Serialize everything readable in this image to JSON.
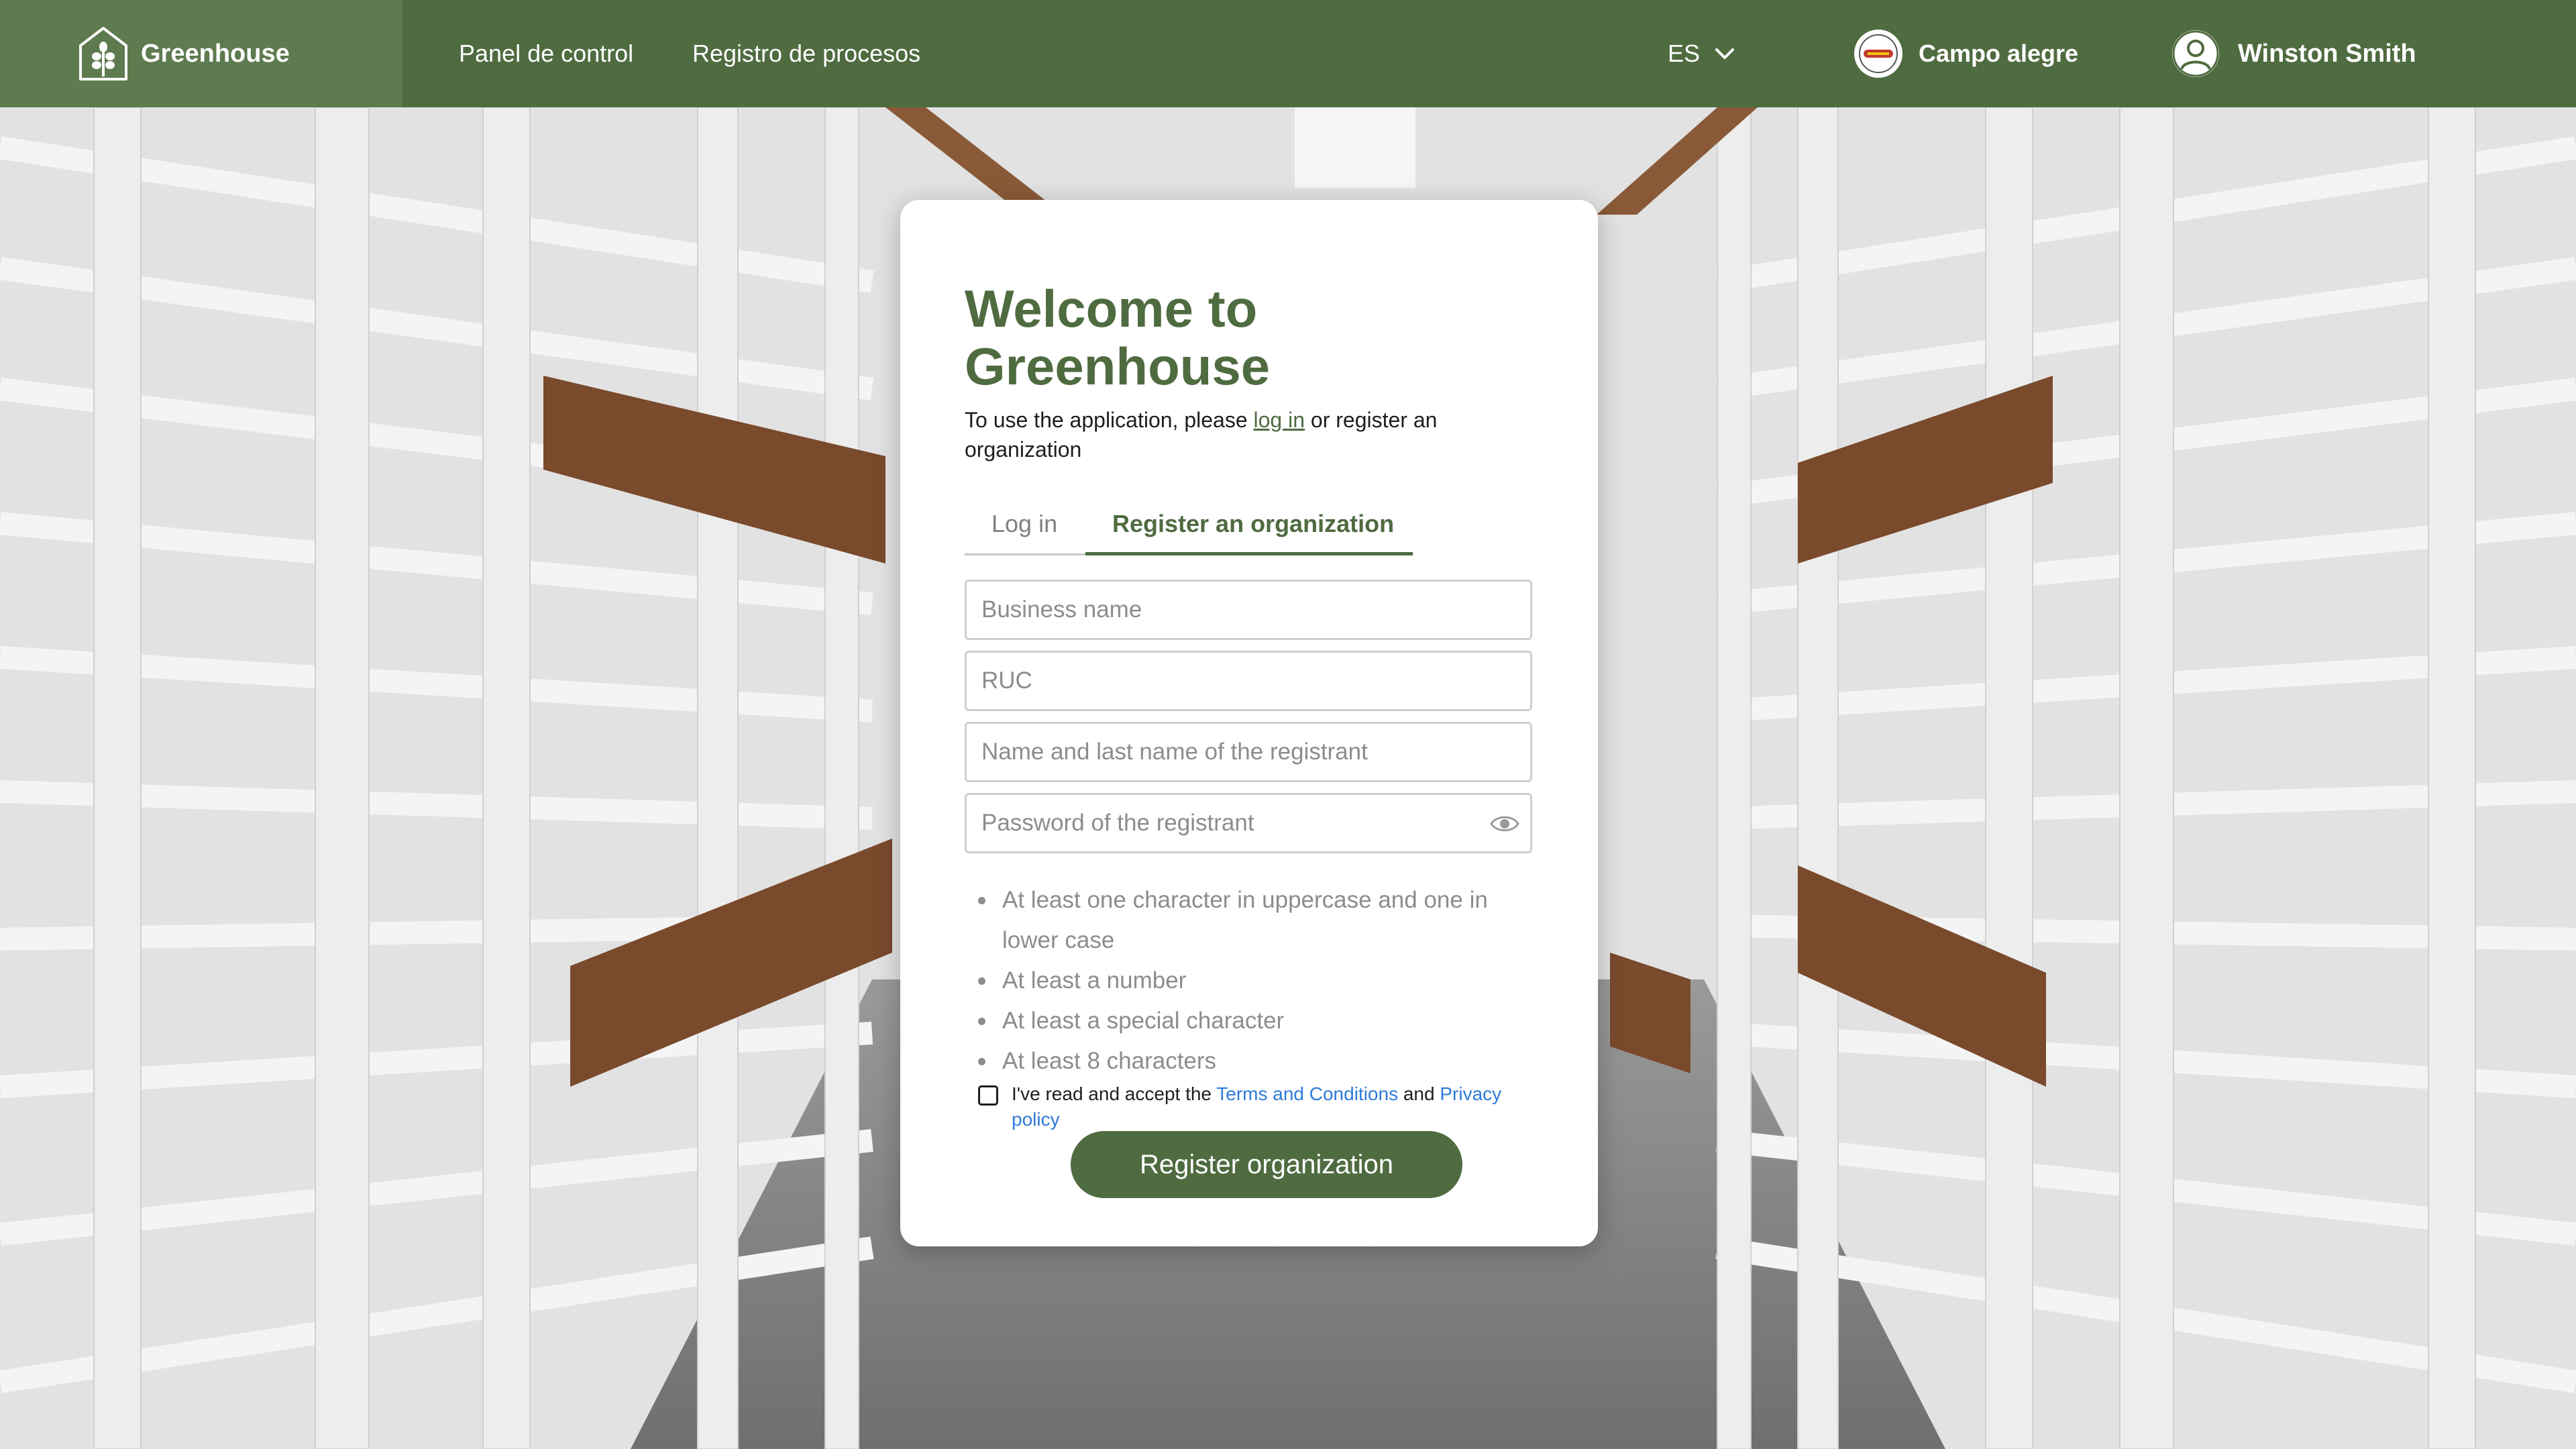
{
  "brand": {
    "name": "Greenhouse"
  },
  "nav": {
    "links": [
      "Panel de control",
      "Registro de procesos"
    ],
    "language": "ES",
    "organization": "Campo alegre",
    "user": "Winston Smith"
  },
  "card": {
    "title": "Welcome to Greenhouse",
    "subtitle_before": "To use the application, please ",
    "subtitle_link": "log in",
    "subtitle_after": " or register an organization",
    "tabs": {
      "login": "Log in",
      "register": "Register an organization",
      "active": "register"
    },
    "fields": {
      "business_name": "Business name",
      "ruc": "RUC",
      "registrant_name": "Name and last name of the registrant",
      "password": "Password of the registrant"
    },
    "password_rules": [
      "At least one character in uppercase and one in lower case",
      "At least a number",
      "At least a special character",
      "At least 8 characters"
    ],
    "terms": {
      "text_before": "I've read and accept the ",
      "terms_link": "Terms and Conditions",
      "text_middle": " and ",
      "privacy_link": "Privacy policy",
      "checked": false
    },
    "submit_label": "Register organization"
  },
  "colors": {
    "primary": "#4f6b40",
    "brand_block": "#5e7a4f",
    "link_blue": "#2f7bd8",
    "muted": "#8c8c8c"
  },
  "icons": [
    "greenhouse-logo-icon",
    "chevron-down-icon",
    "organization-logo-icon",
    "user-avatar-icon",
    "eye-icon"
  ]
}
